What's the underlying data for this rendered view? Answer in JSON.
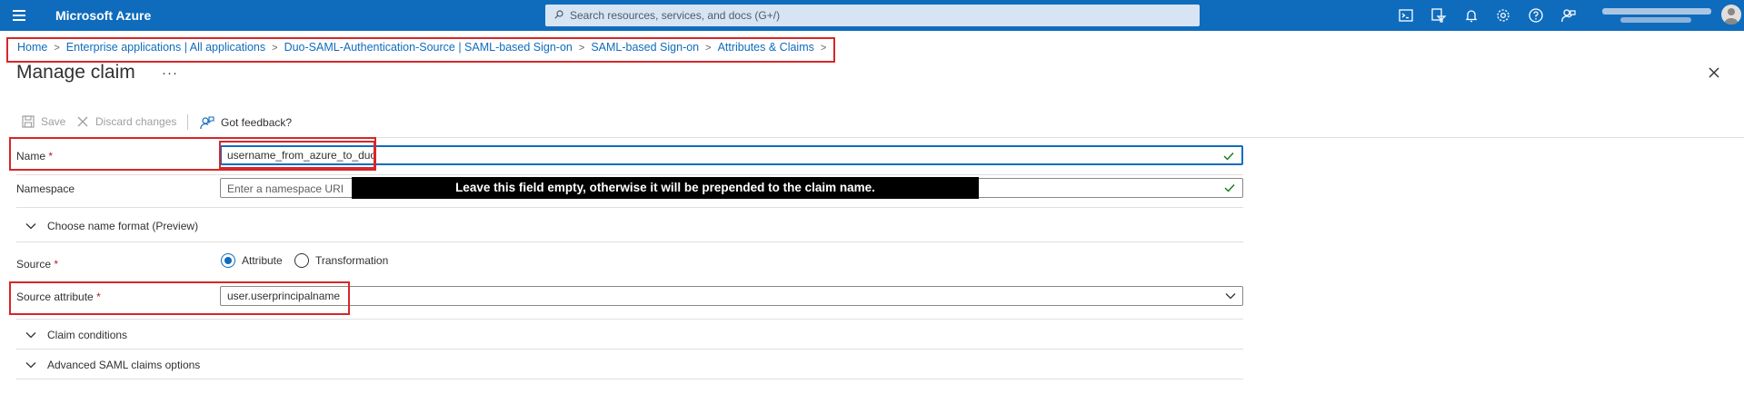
{
  "topbar": {
    "brand": "Microsoft Azure",
    "search_placeholder": "Search resources, services, and docs (G+/)",
    "icons": [
      "cloud-shell-icon",
      "directory-filter-icon",
      "notifications-bell-icon",
      "settings-gear-icon",
      "help-question-icon",
      "feedback-icon"
    ]
  },
  "breadcrumb": {
    "items": [
      "Home",
      "Enterprise applications | All applications",
      "Duo-SAML-Authentication-Source | SAML-based Sign-on",
      "SAML-based Sign-on",
      "Attributes & Claims"
    ],
    "separator": ">"
  },
  "page": {
    "title": "Manage claim",
    "more": "···"
  },
  "commands": {
    "save": "Save",
    "discard": "Discard changes",
    "feedback": "Got feedback?"
  },
  "form": {
    "name_label": "Name",
    "required_mark": "*",
    "name_value": "username_from_azure_to_duo",
    "namespace_label": "Namespace",
    "namespace_placeholder": "Enter a namespace URI",
    "namespace_annotation": "Leave this field empty, otherwise it will be prepended to the claim name.",
    "name_format_expander": "Choose name format (Preview)",
    "source_label": "Source",
    "source_options": [
      "Attribute",
      "Transformation"
    ],
    "source_selected": "Attribute",
    "source_attribute_label": "Source attribute",
    "source_attribute_value": "user.userprincipalname",
    "claim_conditions_expander": "Claim conditions",
    "advanced_expander": "Advanced SAML claims options"
  },
  "colors": {
    "azure_blue": "#0f6cbd",
    "annotation_red": "#d62728",
    "valid_green": "#107c10"
  }
}
